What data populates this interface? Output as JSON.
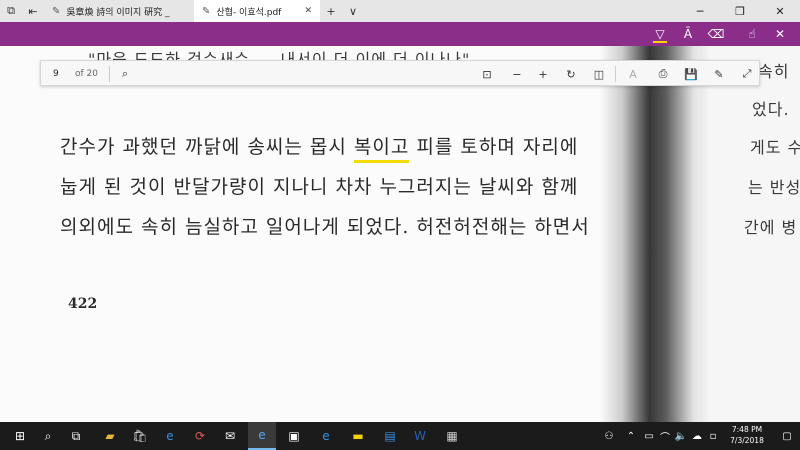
{
  "titlebar": {
    "tabs": [
      {
        "title": "吳章煥 詩의 이미지 硏究 _",
        "active": false
      },
      {
        "title": "산협- 이효석.pdf",
        "active": true
      }
    ],
    "new_tab_symbol": "+",
    "tab_list_symbol": "∨"
  },
  "ink_toolbar": {
    "tools": [
      "highlighter-icon",
      "text-highlight-icon",
      "eraser-icon",
      "touch-write-icon"
    ]
  },
  "reader_toolbar": {
    "page_current": "9",
    "page_total": "of 20"
  },
  "document": {
    "top_cut_line": "\"마음 드드하 걱수새수 ... 내서이 더 이에 더 이나나\"",
    "lines": [
      {
        "before": "간수가 과했던 까닭에 송씨는 몹시 ",
        "marked": "복이고",
        "after": " 피를 토하며 자리에"
      },
      {
        "before": "눕게 된 것이 반달가량이 지나니 차차 누그러지는 날씨와 함께",
        "marked": "",
        "after": ""
      },
      {
        "before": "의외에도 속히 늠실하고 일어나게 되었다. 허전허전해는 하면서",
        "marked": "",
        "after": ""
      }
    ],
    "page_number": "422",
    "right_page_lines": [
      "속히 ",
      "었다.",
      "게도 수",
      "는 반성",
      "간에 병"
    ]
  },
  "taskbar": {
    "clock_time": "7:48 PM",
    "clock_date": "7/3/2018"
  }
}
